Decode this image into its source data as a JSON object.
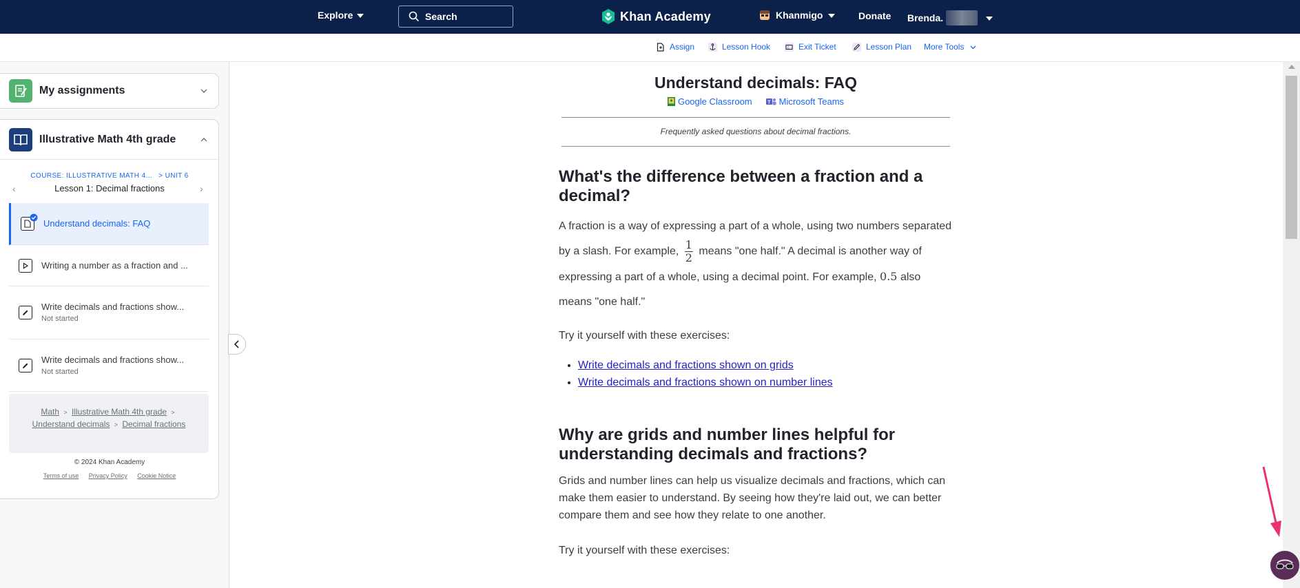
{
  "nav": {
    "explore": "Explore",
    "search_label": "Search",
    "logo": "Khan Academy",
    "khanmigo": "Khanmigo",
    "donate": "Donate",
    "user": "Brenda."
  },
  "tools": {
    "assign": "Assign",
    "lesson_hook": "Lesson Hook",
    "exit_ticket": "Exit Ticket",
    "lesson_plan": "Lesson Plan",
    "more_tools": "More Tools"
  },
  "sidebar": {
    "assignments_title": "My assignments",
    "course_title": "Illustrative Math 4th grade",
    "course_crumb": "COURSE: ILLUSTRATIVE MATH 4...",
    "unit_crumb": "> UNIT 6",
    "lesson_title": "Lesson 1: Decimal fractions",
    "items": [
      {
        "label": "Understand decimals: FAQ",
        "sub": ""
      },
      {
        "label": "Writing a number as a fraction and ...",
        "sub": ""
      },
      {
        "label": "Write decimals and fractions show...",
        "sub": "Not started"
      },
      {
        "label": "Write decimals and fractions show...",
        "sub": "Not started"
      }
    ],
    "breadcrumb": {
      "math": "Math",
      "course": "Illustrative Math 4th grade",
      "unit": "Understand decimals",
      "lesson": "Decimal fractions",
      "sep": ">"
    },
    "copyright": "© 2024 Khan Academy",
    "footer": {
      "terms": "Terms of use",
      "privacy": "Privacy Policy",
      "cookie": "Cookie Notice"
    }
  },
  "article": {
    "title": "Understand decimals: FAQ",
    "share_google": "Google Classroom",
    "share_teams": "Microsoft Teams",
    "description": "Frequently asked questions about decimal fractions.",
    "q1": {
      "heading": "What's the difference between a fraction and a decimal?",
      "p_a": "A fraction is a way of expressing a part of a whole, using two numbers separated by a slash. For example,",
      "frac_num": "1",
      "frac_den": "2",
      "p_b": "means \"one half.\" A decimal is another way of expressing a part of a whole, using a decimal point. For example,",
      "decimal": "0.5",
      "p_c": "also means \"one half.\"",
      "try": "Try it yourself with these exercises:",
      "links": [
        "Write decimals and fractions shown on grids",
        "Write decimals and fractions shown on number lines"
      ]
    },
    "q2": {
      "heading": "Why are grids and number lines helpful for understanding decimals and fractions?",
      "paragraph": "Grids and number lines can help us visualize decimals and fractions, which can make them easier to understand. By seeing how they're laid out, we can better compare them and see how they relate to one another.",
      "try": "Try it yourself with these exercises:"
    }
  },
  "colors": {
    "nav_bg": "#0b2149",
    "link_blue": "#1865f2",
    "pointer_pink": "#e8336c"
  }
}
